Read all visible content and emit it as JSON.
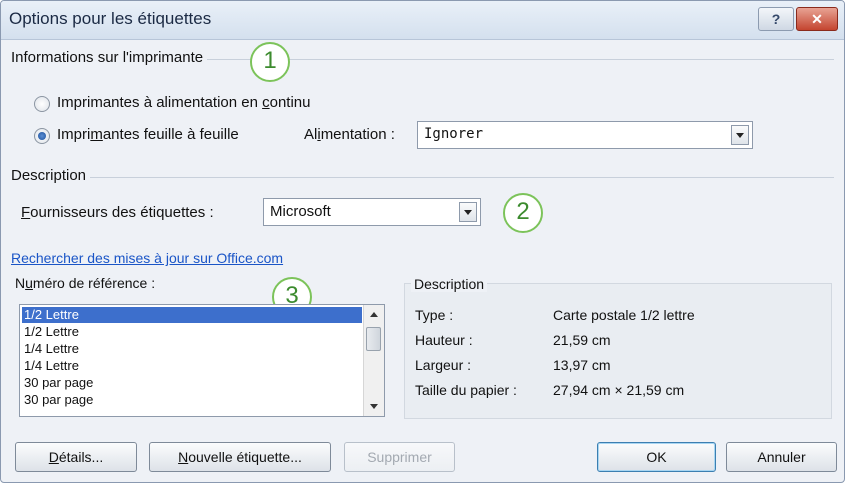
{
  "window": {
    "title": "Options pour les étiquettes",
    "help_label": "?",
    "close_label": "✕"
  },
  "printer": {
    "group_label": "Informations sur l'imprimante",
    "radio_continuous": {
      "pre": "Imprimantes à alimentation en ",
      "acc": "c",
      "post": "ontinu"
    },
    "radio_sheet": {
      "pre": "Impri",
      "acc": "m",
      "post": "antes feuille à feuille"
    },
    "feed_label": {
      "pre": "Al",
      "acc": "i",
      "post": "mentation :"
    },
    "feed_value": "Ignorer"
  },
  "description_section": {
    "group_label": "Description",
    "vendor_label": {
      "acc": "F",
      "post": "ournisseurs des étiquettes :"
    },
    "vendor_value": "Microsoft"
  },
  "update_link": "Rechercher des mises à jour sur Office.com",
  "reference": {
    "label": {
      "pre": "N",
      "acc": "u",
      "post": "méro de référence :"
    },
    "items": [
      "1/2 Lettre",
      "1/2 Lettre",
      "1/4 Lettre",
      "1/4 Lettre",
      "30 par page",
      "30 par page"
    ],
    "selected_index": 0
  },
  "details": {
    "group_label": "Description",
    "rows": [
      {
        "key": "Type :",
        "value": "Carte postale 1/2 lettre"
      },
      {
        "key": "Hauteur :",
        "value": "21,59 cm"
      },
      {
        "key": "Largeur :",
        "value": "13,97 cm"
      },
      {
        "key": "Taille du papier :",
        "value": "27,94 cm × 21,59 cm"
      }
    ]
  },
  "callouts": [
    "1",
    "2",
    "3"
  ],
  "buttons": {
    "details": {
      "acc": "D",
      "post": "étails..."
    },
    "new_label": {
      "acc": "N",
      "post": "ouvelle étiquette..."
    },
    "delete": "Supprimer",
    "ok": "OK",
    "cancel": "Annuler"
  },
  "colors": {
    "link": "#1a55c7",
    "callout": "#7cc35a",
    "selection": "#3d6fcc"
  }
}
